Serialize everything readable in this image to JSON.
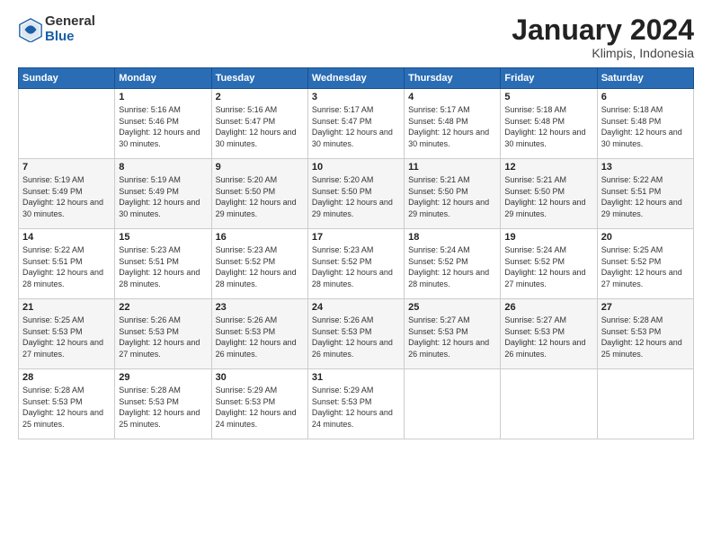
{
  "header": {
    "logo_general": "General",
    "logo_blue": "Blue",
    "title": "January 2024",
    "location": "Klimpis, Indonesia"
  },
  "days_of_week": [
    "Sunday",
    "Monday",
    "Tuesday",
    "Wednesday",
    "Thursday",
    "Friday",
    "Saturday"
  ],
  "weeks": [
    [
      {
        "day": "",
        "sunrise": "",
        "sunset": "",
        "daylight": ""
      },
      {
        "day": "1",
        "sunrise": "Sunrise: 5:16 AM",
        "sunset": "Sunset: 5:46 PM",
        "daylight": "Daylight: 12 hours and 30 minutes."
      },
      {
        "day": "2",
        "sunrise": "Sunrise: 5:16 AM",
        "sunset": "Sunset: 5:47 PM",
        "daylight": "Daylight: 12 hours and 30 minutes."
      },
      {
        "day": "3",
        "sunrise": "Sunrise: 5:17 AM",
        "sunset": "Sunset: 5:47 PM",
        "daylight": "Daylight: 12 hours and 30 minutes."
      },
      {
        "day": "4",
        "sunrise": "Sunrise: 5:17 AM",
        "sunset": "Sunset: 5:48 PM",
        "daylight": "Daylight: 12 hours and 30 minutes."
      },
      {
        "day": "5",
        "sunrise": "Sunrise: 5:18 AM",
        "sunset": "Sunset: 5:48 PM",
        "daylight": "Daylight: 12 hours and 30 minutes."
      },
      {
        "day": "6",
        "sunrise": "Sunrise: 5:18 AM",
        "sunset": "Sunset: 5:48 PM",
        "daylight": "Daylight: 12 hours and 30 minutes."
      }
    ],
    [
      {
        "day": "7",
        "sunrise": "Sunrise: 5:19 AM",
        "sunset": "Sunset: 5:49 PM",
        "daylight": "Daylight: 12 hours and 30 minutes."
      },
      {
        "day": "8",
        "sunrise": "Sunrise: 5:19 AM",
        "sunset": "Sunset: 5:49 PM",
        "daylight": "Daylight: 12 hours and 30 minutes."
      },
      {
        "day": "9",
        "sunrise": "Sunrise: 5:20 AM",
        "sunset": "Sunset: 5:50 PM",
        "daylight": "Daylight: 12 hours and 29 minutes."
      },
      {
        "day": "10",
        "sunrise": "Sunrise: 5:20 AM",
        "sunset": "Sunset: 5:50 PM",
        "daylight": "Daylight: 12 hours and 29 minutes."
      },
      {
        "day": "11",
        "sunrise": "Sunrise: 5:21 AM",
        "sunset": "Sunset: 5:50 PM",
        "daylight": "Daylight: 12 hours and 29 minutes."
      },
      {
        "day": "12",
        "sunrise": "Sunrise: 5:21 AM",
        "sunset": "Sunset: 5:50 PM",
        "daylight": "Daylight: 12 hours and 29 minutes."
      },
      {
        "day": "13",
        "sunrise": "Sunrise: 5:22 AM",
        "sunset": "Sunset: 5:51 PM",
        "daylight": "Daylight: 12 hours and 29 minutes."
      }
    ],
    [
      {
        "day": "14",
        "sunrise": "Sunrise: 5:22 AM",
        "sunset": "Sunset: 5:51 PM",
        "daylight": "Daylight: 12 hours and 28 minutes."
      },
      {
        "day": "15",
        "sunrise": "Sunrise: 5:23 AM",
        "sunset": "Sunset: 5:51 PM",
        "daylight": "Daylight: 12 hours and 28 minutes."
      },
      {
        "day": "16",
        "sunrise": "Sunrise: 5:23 AM",
        "sunset": "Sunset: 5:52 PM",
        "daylight": "Daylight: 12 hours and 28 minutes."
      },
      {
        "day": "17",
        "sunrise": "Sunrise: 5:23 AM",
        "sunset": "Sunset: 5:52 PM",
        "daylight": "Daylight: 12 hours and 28 minutes."
      },
      {
        "day": "18",
        "sunrise": "Sunrise: 5:24 AM",
        "sunset": "Sunset: 5:52 PM",
        "daylight": "Daylight: 12 hours and 28 minutes."
      },
      {
        "day": "19",
        "sunrise": "Sunrise: 5:24 AM",
        "sunset": "Sunset: 5:52 PM",
        "daylight": "Daylight: 12 hours and 27 minutes."
      },
      {
        "day": "20",
        "sunrise": "Sunrise: 5:25 AM",
        "sunset": "Sunset: 5:52 PM",
        "daylight": "Daylight: 12 hours and 27 minutes."
      }
    ],
    [
      {
        "day": "21",
        "sunrise": "Sunrise: 5:25 AM",
        "sunset": "Sunset: 5:53 PM",
        "daylight": "Daylight: 12 hours and 27 minutes."
      },
      {
        "day": "22",
        "sunrise": "Sunrise: 5:26 AM",
        "sunset": "Sunset: 5:53 PM",
        "daylight": "Daylight: 12 hours and 27 minutes."
      },
      {
        "day": "23",
        "sunrise": "Sunrise: 5:26 AM",
        "sunset": "Sunset: 5:53 PM",
        "daylight": "Daylight: 12 hours and 26 minutes."
      },
      {
        "day": "24",
        "sunrise": "Sunrise: 5:26 AM",
        "sunset": "Sunset: 5:53 PM",
        "daylight": "Daylight: 12 hours and 26 minutes."
      },
      {
        "day": "25",
        "sunrise": "Sunrise: 5:27 AM",
        "sunset": "Sunset: 5:53 PM",
        "daylight": "Daylight: 12 hours and 26 minutes."
      },
      {
        "day": "26",
        "sunrise": "Sunrise: 5:27 AM",
        "sunset": "Sunset: 5:53 PM",
        "daylight": "Daylight: 12 hours and 26 minutes."
      },
      {
        "day": "27",
        "sunrise": "Sunrise: 5:28 AM",
        "sunset": "Sunset: 5:53 PM",
        "daylight": "Daylight: 12 hours and 25 minutes."
      }
    ],
    [
      {
        "day": "28",
        "sunrise": "Sunrise: 5:28 AM",
        "sunset": "Sunset: 5:53 PM",
        "daylight": "Daylight: 12 hours and 25 minutes."
      },
      {
        "day": "29",
        "sunrise": "Sunrise: 5:28 AM",
        "sunset": "Sunset: 5:53 PM",
        "daylight": "Daylight: 12 hours and 25 minutes."
      },
      {
        "day": "30",
        "sunrise": "Sunrise: 5:29 AM",
        "sunset": "Sunset: 5:53 PM",
        "daylight": "Daylight: 12 hours and 24 minutes."
      },
      {
        "day": "31",
        "sunrise": "Sunrise: 5:29 AM",
        "sunset": "Sunset: 5:53 PM",
        "daylight": "Daylight: 12 hours and 24 minutes."
      },
      {
        "day": "",
        "sunrise": "",
        "sunset": "",
        "daylight": ""
      },
      {
        "day": "",
        "sunrise": "",
        "sunset": "",
        "daylight": ""
      },
      {
        "day": "",
        "sunrise": "",
        "sunset": "",
        "daylight": ""
      }
    ]
  ]
}
